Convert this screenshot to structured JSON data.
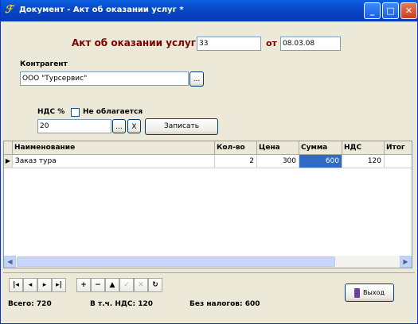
{
  "window": {
    "title": "Документ - Акт об оказании услуг *"
  },
  "form": {
    "heading": "Акт об оказании услуг №",
    "number": "33",
    "date_label": "от",
    "date": "08.03.08",
    "contractor_label": "Контрагент",
    "contractor_value": "ООО \"Турсервис\"",
    "browse_label": "...",
    "vat_label": "НДС %",
    "vat_exempt_label": "Не облагается",
    "vat_exempt_checked": false,
    "vat_value": "20",
    "clear_label": "X",
    "save_label": "Записать"
  },
  "grid": {
    "columns": [
      "Наименование",
      "Кол-во",
      "Цена",
      "Сумма",
      "НДС",
      "Итог"
    ],
    "rows": [
      {
        "name": "Заказ тура",
        "qty": "2",
        "price": "300",
        "sum": "600",
        "vat": "120"
      }
    ]
  },
  "navigator": {
    "buttons": [
      "first",
      "prior",
      "next",
      "last",
      "insert",
      "delete",
      "edit",
      "post",
      "cancel",
      "refresh"
    ]
  },
  "footer": {
    "total": "Всего: 720",
    "vat_incl": "В т.ч. НДС:  120",
    "no_tax": "Без налогов: 600",
    "exit_label": "Выход"
  }
}
